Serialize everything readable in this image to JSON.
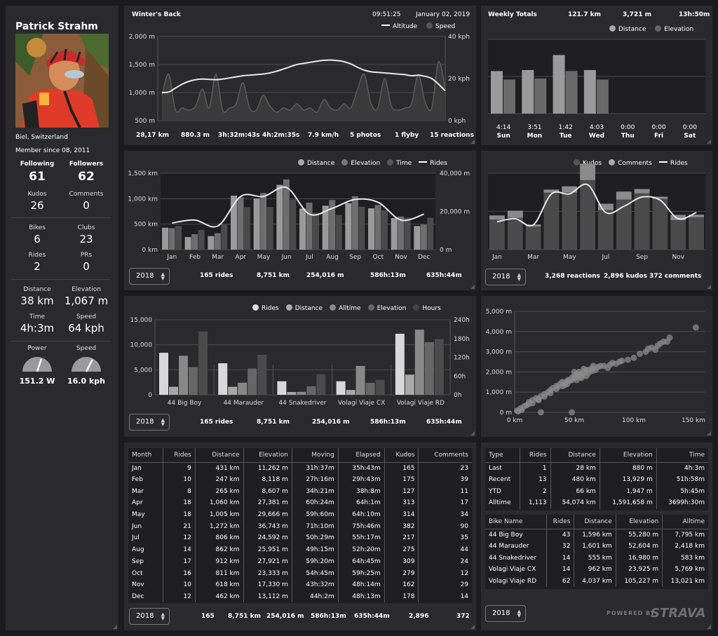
{
  "profile": {
    "name": "Patrick Strahm",
    "location": "Biel, Switzerland",
    "member_since": "Member since 08, 2011",
    "following_label": "Following",
    "following": "61",
    "followers_label": "Followers",
    "followers": "62",
    "kudos_label": "Kudos",
    "kudos": "26",
    "comments_label": "Comments",
    "comments": "0",
    "bikes_label": "Bikes",
    "bikes": "6",
    "clubs_label": "Clubs",
    "clubs": "23",
    "rides_label": "Rides",
    "rides": "2",
    "prs_label": "PRs",
    "prs": "0",
    "distance_label": "Distance",
    "distance": "38 km",
    "elevation_label": "Elevation",
    "elevation": "1,067 m",
    "time_label": "Time",
    "time": "4h:3m",
    "speed_label": "Speed",
    "speed": "64 kph",
    "power_label": "Power",
    "power_value": "151.2 W",
    "power_fraction": 0.6,
    "speed2_label": "Speed",
    "speed2_value": "16.0 kph",
    "speed2_fraction": 0.65
  },
  "ride": {
    "title": "Winter's Back",
    "time": "09:51:25",
    "date": "January 02, 2019",
    "legend_altitude": "Altitude",
    "legend_speed": "Speed",
    "stats": [
      "28,17 km",
      "880.3 m",
      "3h:32m:43s",
      "4h:2m:35s",
      "7.9 km/h",
      "5 photos",
      "1 flyby",
      "15 reactions"
    ]
  },
  "weekly": {
    "title": "Weekly Totals",
    "distance": "121.7 km",
    "elevation": "3,721 m",
    "time": "13h:50m",
    "legend_distance": "Distance",
    "legend_elevation": "Elevation"
  },
  "monthly": {
    "legend": [
      "Distance",
      "Elevation",
      "Time",
      "Rides"
    ],
    "year": "2018",
    "summary": [
      "165 rides",
      "8,751 km",
      "254,016 m",
      "586h:13m",
      "635h:44m"
    ]
  },
  "social": {
    "legend": [
      "Kudos",
      "Comments",
      "Rides"
    ],
    "year": "2018",
    "summary": [
      "3,268 reactions",
      "2,896 kudos",
      "372 comments"
    ]
  },
  "bikes_chart": {
    "legend": [
      "Rides",
      "Distance",
      "Alltime",
      "Elevation",
      "Hours"
    ],
    "year": "2018",
    "summary": [
      "165 rides",
      "8,751 km",
      "254,016 m",
      "586h:13m",
      "635h:44m"
    ]
  },
  "month_table": {
    "headers": [
      "Month",
      "Rides",
      "Distance",
      "Elevation",
      "Moving",
      "Elapsed",
      "Kudos",
      "Comments"
    ],
    "rows": [
      [
        "Jan",
        "9",
        "431 km",
        "11,262 m",
        "31h:37m",
        "35h:43m",
        "165",
        "23"
      ],
      [
        "Feb",
        "10",
        "247 km",
        "8,118 m",
        "27h:16m",
        "29h:43m",
        "175",
        "39"
      ],
      [
        "Mar",
        "8",
        "265 km",
        "8,607 m",
        "34h:21m",
        "38h:8m",
        "127",
        "11"
      ],
      [
        "Apr",
        "18",
        "1,060 km",
        "27,381 m",
        "60h:24m",
        "64h:1m",
        "313",
        "17"
      ],
      [
        "May",
        "18",
        "1,005 km",
        "29,666 m",
        "59h:60m",
        "64h:10m",
        "314",
        "34"
      ],
      [
        "Jun",
        "21",
        "1,272 km",
        "36,743 m",
        "71h:10m",
        "75h:46m",
        "382",
        "90"
      ],
      [
        "Jul",
        "12",
        "806 km",
        "24,592 m",
        "50h:29m",
        "55h:17m",
        "217",
        "35"
      ],
      [
        "Aug",
        "14",
        "862 km",
        "25,951 m",
        "49h:15m",
        "52h:20m",
        "275",
        "44"
      ],
      [
        "Sep",
        "17",
        "912 km",
        "27,921 m",
        "59h:20m",
        "64h:45m",
        "309",
        "24"
      ],
      [
        "Oct",
        "16",
        "811 km",
        "23,333 m",
        "54h:45m",
        "59h:25m",
        "279",
        "12"
      ],
      [
        "Nov",
        "10",
        "618 km",
        "17,330 m",
        "43h:32m",
        "48h:14m",
        "162",
        "29"
      ],
      [
        "Dec",
        "12",
        "462 km",
        "13,112 m",
        "44h:2m",
        "48h:13m",
        "178",
        "14"
      ]
    ],
    "year": "2018",
    "totals": [
      "165",
      "8,751 km",
      "254,016 m",
      "586h:13m",
      "635h:44m",
      "2,896",
      "372"
    ]
  },
  "type_table": {
    "headers": [
      "Type",
      "Rides",
      "Distance",
      "Elevation",
      "Time"
    ],
    "rows": [
      [
        "Last",
        "1",
        "28 km",
        "880 m",
        "4h:3m"
      ],
      [
        "Recent",
        "13",
        "480 km",
        "13,929 m",
        "51h:58m"
      ],
      [
        "YTD",
        "2",
        "66 km",
        "1,947 m",
        "5h:45m"
      ],
      [
        "Alltime",
        "1,113",
        "54,074 km",
        "1,591,658 m",
        "3699h:30m"
      ]
    ]
  },
  "bike_table": {
    "headers": [
      "Bike Name",
      "Rides",
      "Distance",
      "Elevation",
      "Alltime"
    ],
    "rows": [
      [
        "44 Big Boy",
        "43",
        "1,596 km",
        "55,280 m",
        "7,795 km"
      ],
      [
        "44 Marauder",
        "32",
        "1,601 km",
        "52,604 m",
        "2,418 km"
      ],
      [
        "44 Snakedriver",
        "14",
        "555 km",
        "16,980 m",
        "583 km"
      ],
      [
        "Volagi Viaje CX",
        "14",
        "962 km",
        "23,925 m",
        "5,769 km"
      ],
      [
        "Volagi Viaje RD",
        "62",
        "4,037 km",
        "105,227 m",
        "13,021 km"
      ]
    ],
    "year": "2018"
  },
  "branding": {
    "powered_by": "POWERED BY",
    "brand": "STRAVA"
  },
  "chart_data": [
    {
      "id": "ride-profile",
      "type": "line",
      "title": "Winter's Back",
      "y_left_ticks": [
        "2,000 m",
        "1,500 m",
        "1,000 m",
        "500 m"
      ],
      "ylim_left": [
        500,
        2000
      ],
      "y_right_ticks": [
        "40 kph",
        "20 kph",
        "0 kph"
      ],
      "ylim_right": [
        0,
        40
      ],
      "series": [
        {
          "name": "Altitude",
          "values": [
            1000,
            1010,
            1080,
            1150,
            1200,
            1230,
            1240,
            1235,
            1230,
            1240,
            1260,
            1280,
            1300,
            1310,
            1320,
            1330,
            1350,
            1380,
            1420,
            1460,
            1500,
            1520,
            1540,
            1560,
            1575,
            1580,
            1570,
            1550,
            1510,
            1450,
            1400,
            1370,
            1360,
            1350,
            1340,
            1330,
            1320,
            1300,
            1310,
            1290,
            1250,
            1150,
            1030
          ]
        },
        {
          "name": "Speed",
          "values": [
            12,
            22,
            5,
            6,
            5,
            7,
            15,
            6,
            22,
            5,
            6,
            8,
            18,
            6,
            5,
            12,
            7,
            4,
            6,
            5,
            8,
            5,
            6,
            4,
            10,
            6,
            5,
            8,
            6,
            15,
            22,
            8,
            6,
            20,
            7,
            5,
            6,
            8,
            22,
            9,
            6,
            28,
            15
          ]
        }
      ]
    },
    {
      "id": "weekly-totals",
      "type": "bar",
      "categories": [
        "Sun",
        "Mon",
        "Tue",
        "Wed",
        "Thu",
        "Fri",
        "Sat"
      ],
      "time_labels": [
        "4:14",
        "3:51",
        "1:42",
        "4:03",
        "0:00",
        "0:00",
        "0:00"
      ],
      "series": [
        {
          "name": "Distance",
          "values": [
            28.6,
            29.3,
            39.4,
            29.3,
            0,
            0,
            0
          ]
        },
        {
          "name": "Elevation",
          "values": [
            22.9,
            23.6,
            28.6,
            22.9,
            0,
            0,
            0
          ]
        }
      ],
      "ylim": [
        0,
        50
      ]
    },
    {
      "id": "monthly-chart",
      "type": "bar",
      "categories": [
        "Jan",
        "Feb",
        "Mar",
        "Apr",
        "May",
        "Jun",
        "Jul",
        "Aug",
        "Sep",
        "Oct",
        "Nov",
        "Dec"
      ],
      "y_left_ticks": [
        "1,500 km",
        "1,000 km",
        "500 km",
        "0 km"
      ],
      "ylim_left": [
        0,
        1500
      ],
      "y_right_ticks": [
        "40,000 m",
        "20,000 m",
        "0 m"
      ],
      "ylim_right": [
        0,
        40000
      ],
      "series": [
        {
          "name": "Distance",
          "values": [
            431,
            247,
            265,
            1060,
            1005,
            1272,
            806,
            862,
            912,
            811,
            618,
            462
          ]
        },
        {
          "name": "Elevation",
          "values": [
            11262,
            8118,
            8607,
            27381,
            29666,
            36743,
            24592,
            25951,
            27921,
            23333,
            17330,
            13112
          ]
        },
        {
          "name": "Time",
          "values": [
            35.7,
            29.7,
            38.1,
            64,
            64.2,
            75.8,
            55.3,
            52.3,
            64.8,
            59.4,
            48.2,
            48.2
          ]
        },
        {
          "name": "Rides",
          "values": [
            9,
            10,
            8,
            18,
            18,
            21,
            12,
            14,
            17,
            16,
            10,
            12
          ]
        }
      ]
    },
    {
      "id": "social-chart",
      "type": "bar",
      "categories": [
        "Jan",
        "Feb",
        "Mar",
        "Apr",
        "May",
        "Jun",
        "Jul",
        "Aug",
        "Sep",
        "Oct",
        "Nov",
        "Dec"
      ],
      "x_tick_labels": [
        "Jan",
        "",
        "Mar",
        "",
        "May",
        "",
        "Jul",
        "",
        "Sep",
        "",
        "Nov",
        ""
      ],
      "series": [
        {
          "name": "Kudos",
          "values": [
            165,
            175,
            127,
            313,
            314,
            382,
            217,
            275,
            309,
            279,
            162,
            178
          ]
        },
        {
          "name": "Comments",
          "values": [
            23,
            39,
            11,
            17,
            34,
            90,
            35,
            44,
            24,
            12,
            29,
            14
          ]
        },
        {
          "name": "Rides",
          "values": [
            9,
            10,
            8,
            18,
            18,
            21,
            12,
            14,
            17,
            16,
            10,
            12
          ]
        }
      ]
    },
    {
      "id": "bikes-chart",
      "type": "bar",
      "categories": [
        "44 Big Boy",
        "44 Marauder",
        "44 Snakedriver",
        "Volagi Viaje CX",
        "Volagi Viaje RD"
      ],
      "y_left_ticks": [
        "15,000",
        "10,000",
        "5,000",
        "0"
      ],
      "ylim_left": [
        0,
        15000
      ],
      "y_right_ticks": [
        "240h",
        "180h",
        "120h",
        "60h",
        "0h"
      ],
      "ylim_right": [
        0,
        240
      ],
      "series": [
        {
          "name": "Rides",
          "values": [
            8400,
            6300,
            2700,
            2700,
            12200
          ]
        },
        {
          "name": "Distance",
          "values": [
            1596,
            1601,
            555,
            962,
            4037
          ]
        },
        {
          "name": "Alltime",
          "values": [
            7795,
            2418,
            583,
            5769,
            13021
          ]
        },
        {
          "name": "Elevation",
          "values": [
            5528,
            5260,
            1698,
            2392,
            10523
          ]
        },
        {
          "name": "Hours",
          "values": [
            202,
            128,
            65,
            48,
            178
          ]
        }
      ]
    },
    {
      "id": "scatter-chart",
      "type": "scatter",
      "x_ticks": [
        "0 km",
        "50 km",
        "100 km",
        "150 km"
      ],
      "xlim": [
        0,
        160
      ],
      "y_ticks": [
        "5,000 m",
        "4,000 m",
        "3,000 m",
        "2,000 m",
        "1,000 m",
        "0 m"
      ],
      "ylim": [
        0,
        5000
      ],
      "points": [
        [
          2,
          80
        ],
        [
          5,
          200
        ],
        [
          8,
          300
        ],
        [
          10,
          350
        ],
        [
          12,
          500
        ],
        [
          15,
          600
        ],
        [
          18,
          700
        ],
        [
          20,
          650
        ],
        [
          22,
          800
        ],
        [
          25,
          900
        ],
        [
          28,
          1000
        ],
        [
          30,
          1100
        ],
        [
          32,
          1200
        ],
        [
          35,
          1300
        ],
        [
          38,
          1400
        ],
        [
          40,
          1500
        ],
        [
          42,
          1450
        ],
        [
          45,
          1600
        ],
        [
          48,
          1700
        ],
        [
          50,
          1800
        ],
        [
          52,
          1750
        ],
        [
          55,
          1900
        ],
        [
          58,
          2000
        ],
        [
          60,
          2100
        ],
        [
          62,
          1950
        ],
        [
          65,
          2200
        ],
        [
          68,
          2100
        ],
        [
          70,
          2250
        ],
        [
          75,
          2300
        ],
        [
          80,
          2350
        ],
        [
          85,
          2400
        ],
        [
          88,
          2500
        ],
        [
          95,
          2600
        ],
        [
          100,
          2700
        ],
        [
          105,
          2900
        ],
        [
          110,
          3000
        ],
        [
          115,
          3200
        ],
        [
          118,
          3100
        ],
        [
          120,
          3300
        ],
        [
          125,
          3500
        ],
        [
          130,
          3700
        ],
        [
          152,
          4200
        ],
        [
          48,
          1600
        ],
        [
          46,
          1550
        ],
        [
          44,
          1400
        ],
        [
          52,
          1900
        ],
        [
          54,
          2000
        ],
        [
          56,
          1850
        ],
        [
          58,
          2150
        ],
        [
          60,
          1800
        ],
        [
          35,
          1150
        ],
        [
          30,
          950
        ],
        [
          25,
          780
        ],
        [
          20,
          600
        ],
        [
          15,
          450
        ],
        [
          40,
          1300
        ],
        [
          42,
          1350
        ],
        [
          50,
          1700
        ],
        [
          55,
          1750
        ],
        [
          65,
          2050
        ],
        [
          72,
          2300
        ],
        [
          78,
          2200
        ],
        [
          82,
          2450
        ],
        [
          90,
          2550
        ],
        [
          112,
          3150
        ],
        [
          122,
          3400
        ],
        [
          128,
          3500
        ],
        [
          48,
          0
        ],
        [
          22,
          0
        ],
        [
          6,
          120
        ],
        [
          3,
          50
        ],
        [
          12,
          420
        ],
        [
          36,
          1250
        ],
        [
          44,
          1550
        ],
        [
          50,
          2000
        ],
        [
          52,
          1600
        ],
        [
          56,
          1700
        ],
        [
          58,
          1900
        ],
        [
          62,
          2100
        ],
        [
          66,
          2300
        ]
      ]
    }
  ]
}
